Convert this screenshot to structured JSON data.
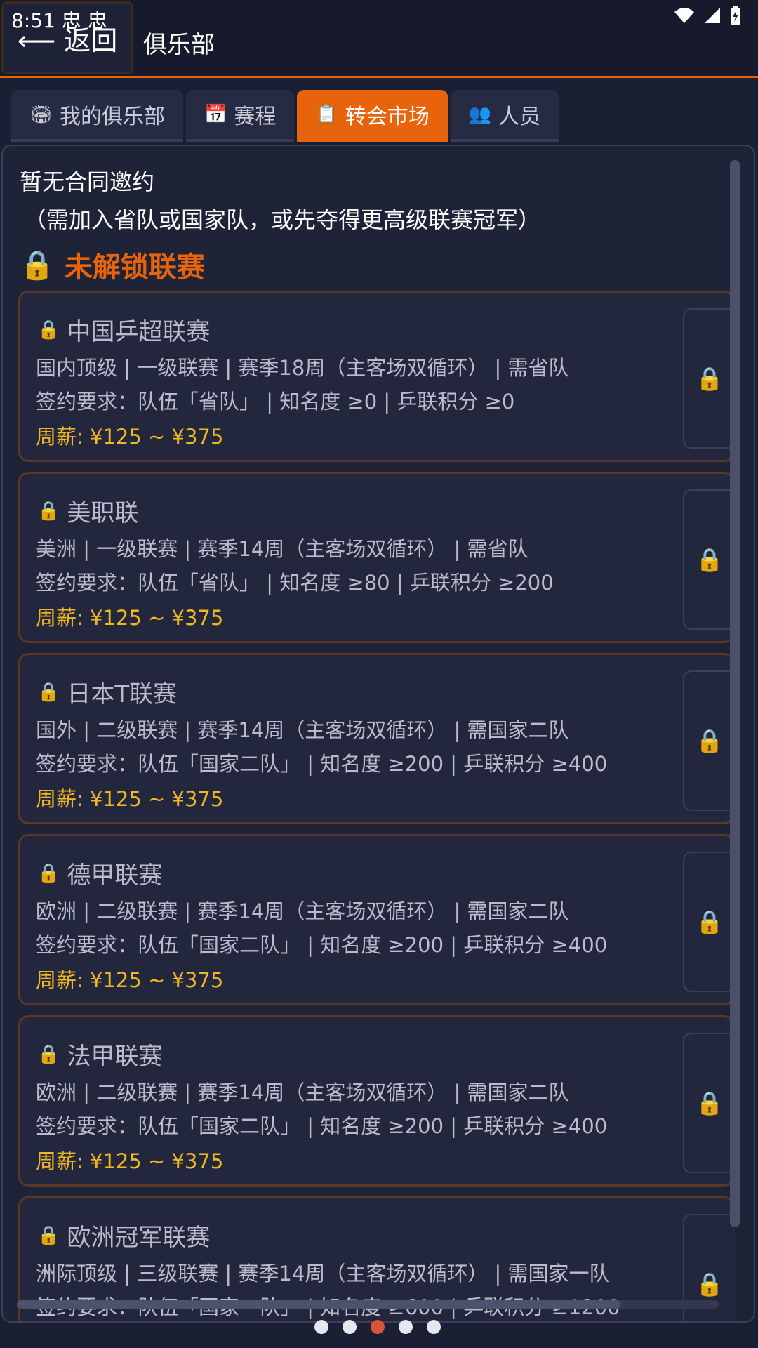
{
  "status_bar": {
    "time": "8:51",
    "notif_icons": "忠 忠"
  },
  "header": {
    "back_label": "⟵ 返回",
    "title": "俱乐部"
  },
  "tabs": [
    {
      "icon": "🏟",
      "label": "我的俱乐部"
    },
    {
      "icon": "📅",
      "label": "赛程"
    },
    {
      "icon": "📋",
      "label": "转会市场"
    },
    {
      "icon": "👥",
      "label": "人员"
    }
  ],
  "main": {
    "notice_title": "暂无合同邀约",
    "notice_sub": "（需加入省队或国家队，或先夺得更高级联赛冠军）",
    "locked_heading": "未解锁联赛",
    "leagues": [
      {
        "name": "中国乒超联赛",
        "info": "国内顶级 | 一级联赛 | 赛季18周（主客场双循环） | 需省队",
        "req": "签约要求：队伍「省队」 | 知名度 ≥0 | 乒联积分 ≥0",
        "salary": "周薪: ¥125 ~ ¥375"
      },
      {
        "name": "美职联",
        "info": "美洲 | 一级联赛 | 赛季14周（主客场双循环） | 需省队",
        "req": "签约要求：队伍「省队」 | 知名度 ≥80 | 乒联积分 ≥200",
        "salary": "周薪: ¥125 ~ ¥375"
      },
      {
        "name": "日本T联赛",
        "info": "国外 | 二级联赛 | 赛季14周（主客场双循环） | 需国家二队",
        "req": "签约要求：队伍「国家二队」 | 知名度 ≥200 | 乒联积分 ≥400",
        "salary": "周薪: ¥125 ~ ¥375"
      },
      {
        "name": "德甲联赛",
        "info": "欧洲 | 二级联赛 | 赛季14周（主客场双循环） | 需国家二队",
        "req": "签约要求：队伍「国家二队」 | 知名度 ≥200 | 乒联积分 ≥400",
        "salary": "周薪: ¥125 ~ ¥375"
      },
      {
        "name": "法甲联赛",
        "info": "欧洲 | 二级联赛 | 赛季14周（主客场双循环） | 需国家二队",
        "req": "签约要求：队伍「国家二队」 | 知名度 ≥200 | 乒联积分 ≥400",
        "salary": "周薪: ¥125 ~ ¥375"
      },
      {
        "name": "欧洲冠军联赛",
        "info": "洲际顶级 | 三级联赛 | 赛季14周（主客场双循环） | 需国家一队",
        "req": "签约要求：队伍「国家一队」 | 知名度 ≥600 | 乒联积分 ≥1200",
        "salary": ""
      }
    ]
  },
  "page_dots": {
    "count": 5,
    "active_index": 2
  },
  "colors": {
    "accent": "#e8640c",
    "salary": "#f0b820",
    "background": "#1b1f33"
  }
}
